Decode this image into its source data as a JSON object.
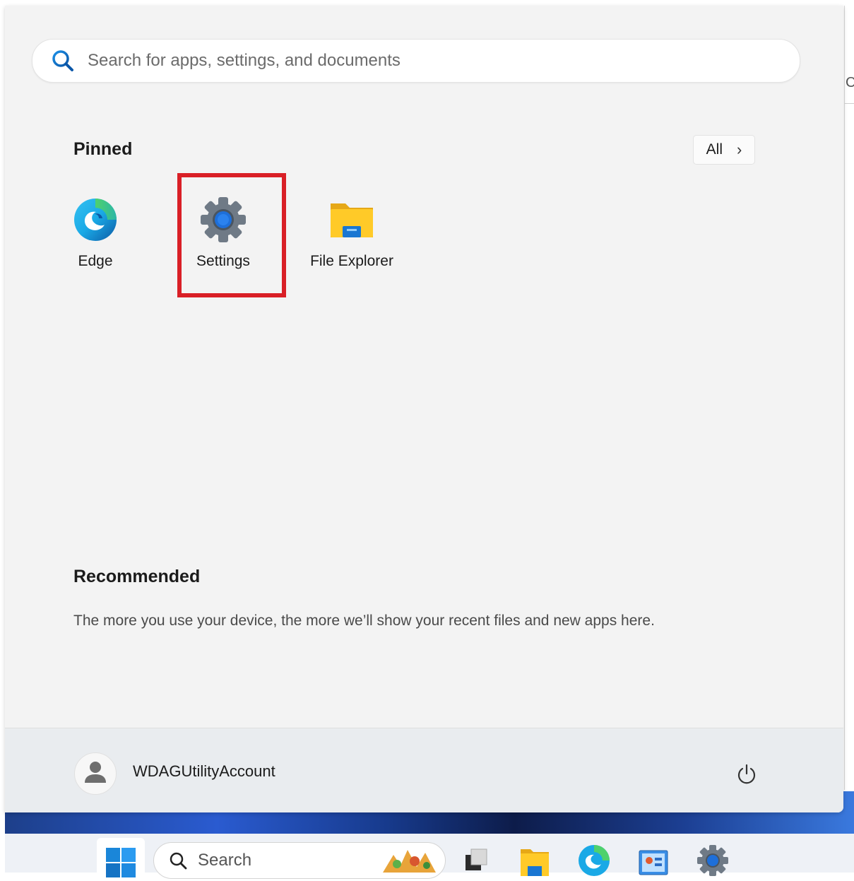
{
  "start_menu": {
    "search": {
      "placeholder": "Search for apps, settings, and documents"
    },
    "pinned": {
      "title": "Pinned",
      "all_button_label": "All",
      "apps": [
        {
          "label": "Edge",
          "icon": "edge-icon"
        },
        {
          "label": "Settings",
          "icon": "settings-gear-icon"
        },
        {
          "label": "File Explorer",
          "icon": "folder-icon"
        }
      ]
    },
    "recommended": {
      "title": "Recommended",
      "empty_text": "The more you use your device, the more we’ll show your recent files and new apps here."
    },
    "user": {
      "name": "WDAGUtilityAccount"
    }
  },
  "taskbar": {
    "search_label": "Search",
    "items": [
      "windows-start-icon",
      "search-icon",
      "task-view-icon",
      "file-explorer-icon",
      "edge-icon",
      "control-panel-icon",
      "settings-icon"
    ]
  },
  "colors": {
    "highlight": "#d91f26",
    "accent": "#0f6cbd",
    "menu_bg": "#f3f3f3"
  }
}
